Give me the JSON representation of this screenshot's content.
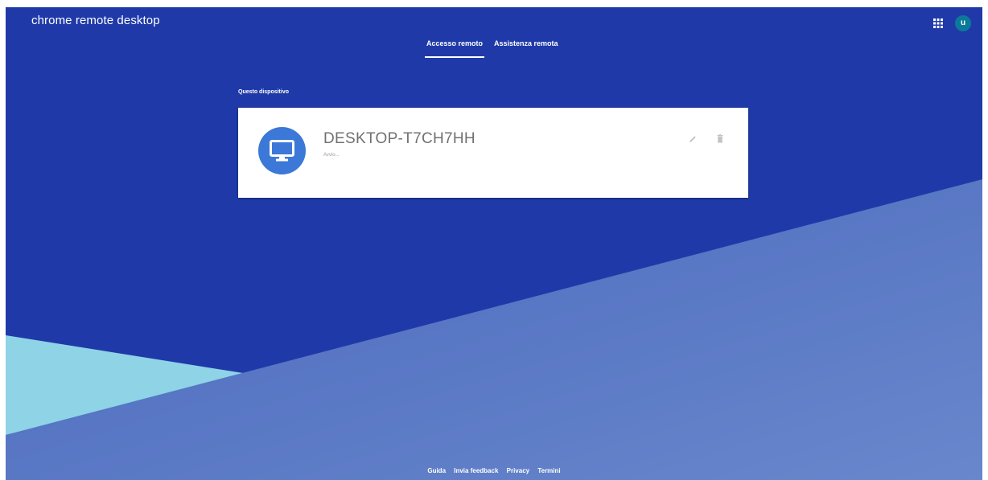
{
  "header": {
    "title": "chrome remote desktop",
    "avatar_letter": "u",
    "apps_icon": "apps-grid-icon"
  },
  "tabs": [
    {
      "label": "Accesso remoto",
      "active": true
    },
    {
      "label": "Assistenza remota",
      "active": false
    }
  ],
  "section": {
    "label": "Questo dispositivo"
  },
  "device": {
    "name": "DESKTOP-T7CH7HH",
    "status": "Avvio...",
    "icon": "monitor-icon",
    "actions": [
      "edit-icon",
      "delete-icon"
    ]
  },
  "footer": {
    "links": [
      "Guida",
      "Invia feedback",
      "Privacy",
      "Termini"
    ]
  },
  "colors": {
    "background_dark": "#1f3aa8",
    "background_light": "#5b7bc7",
    "accent_cyan": "#8fd3e6",
    "device_avatar": "#3b78d8",
    "profile_avatar": "#0b7a9a"
  }
}
